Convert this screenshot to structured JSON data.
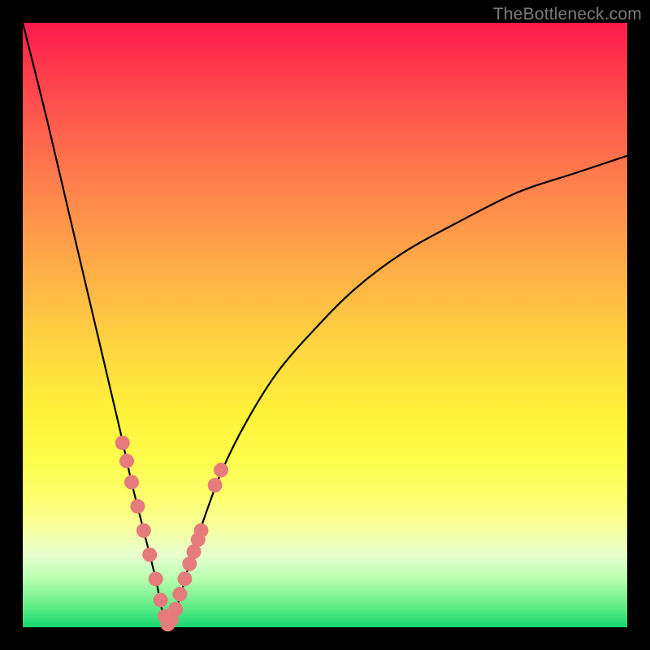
{
  "watermark": "TheBottleneck.com",
  "colors": {
    "curve": "#000000",
    "marker_fill": "#e57b7b",
    "marker_stroke": "#c56060",
    "gradient_top": "#ff1a4b",
    "gradient_bottom": "#15d870"
  },
  "chart_data": {
    "type": "line",
    "title": "",
    "xlabel": "",
    "ylabel": "",
    "xlim": [
      0,
      100
    ],
    "ylim": [
      0,
      100
    ],
    "grid": false,
    "legend": false,
    "description": "Absolute-value-like bottleneck curve with minimum near x≈24 dipping to y≈0. Left branch falls steeply from y≈100 at x=0; right branch rises concavely toward y≈78 at x=100. Marker cluster (salmon dots) concentrated around the valley on both branches between roughly 60% and 90% chart height.",
    "curve": {
      "x": [
        0,
        4,
        8,
        12,
        16,
        18,
        20,
        22,
        23,
        24,
        25,
        26,
        28,
        30,
        33,
        37,
        42,
        48,
        55,
        63,
        72,
        82,
        91,
        100
      ],
      "y": [
        100,
        84,
        67,
        50,
        33,
        24,
        16,
        8,
        3,
        0,
        2,
        5,
        12,
        18,
        26,
        34,
        42,
        49,
        56,
        62,
        67,
        72,
        75,
        78
      ]
    },
    "series": [
      {
        "name": "markers",
        "x": [
          16.5,
          17.2,
          18.0,
          19.0,
          20.0,
          21.0,
          22.0,
          22.8,
          23.5,
          24.0,
          24.6,
          25.3,
          26.0,
          26.8,
          27.6,
          28.3,
          29.0,
          29.5,
          31.8,
          32.8
        ],
        "y": [
          30.5,
          27.5,
          24.0,
          20.0,
          16.0,
          12.0,
          8.0,
          4.5,
          1.8,
          0.5,
          1.2,
          3.0,
          5.5,
          8.0,
          10.5,
          12.5,
          14.5,
          16.0,
          23.5,
          26.0
        ]
      }
    ]
  }
}
